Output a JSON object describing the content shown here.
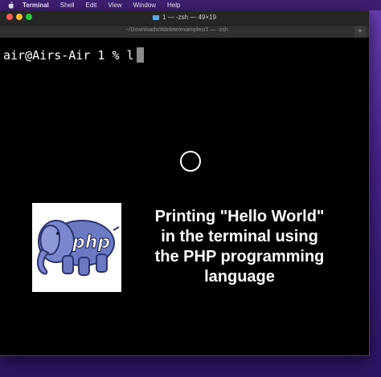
{
  "menubar": {
    "app_name": "Terminal",
    "items": [
      "Shell",
      "Edit",
      "View",
      "Window",
      "Help"
    ]
  },
  "window": {
    "title": "1 — -zsh — 49×19",
    "tab_label": "~/Downloads/#delete/examples/1 — -zsh",
    "new_tab_symbol": "+"
  },
  "terminal": {
    "prompt": "air@Airs-Air 1 % l"
  },
  "overlay": {
    "logo_text": "php",
    "caption_lines": [
      "Printing \"Hello World\"",
      "in the terminal using",
      "the PHP programming",
      "language"
    ]
  },
  "colors": {
    "close": "#ff5f57",
    "minimize": "#febc2e",
    "maximize": "#28c840",
    "terminal_bg": "#000000",
    "elephant": "#6c7ac4"
  }
}
